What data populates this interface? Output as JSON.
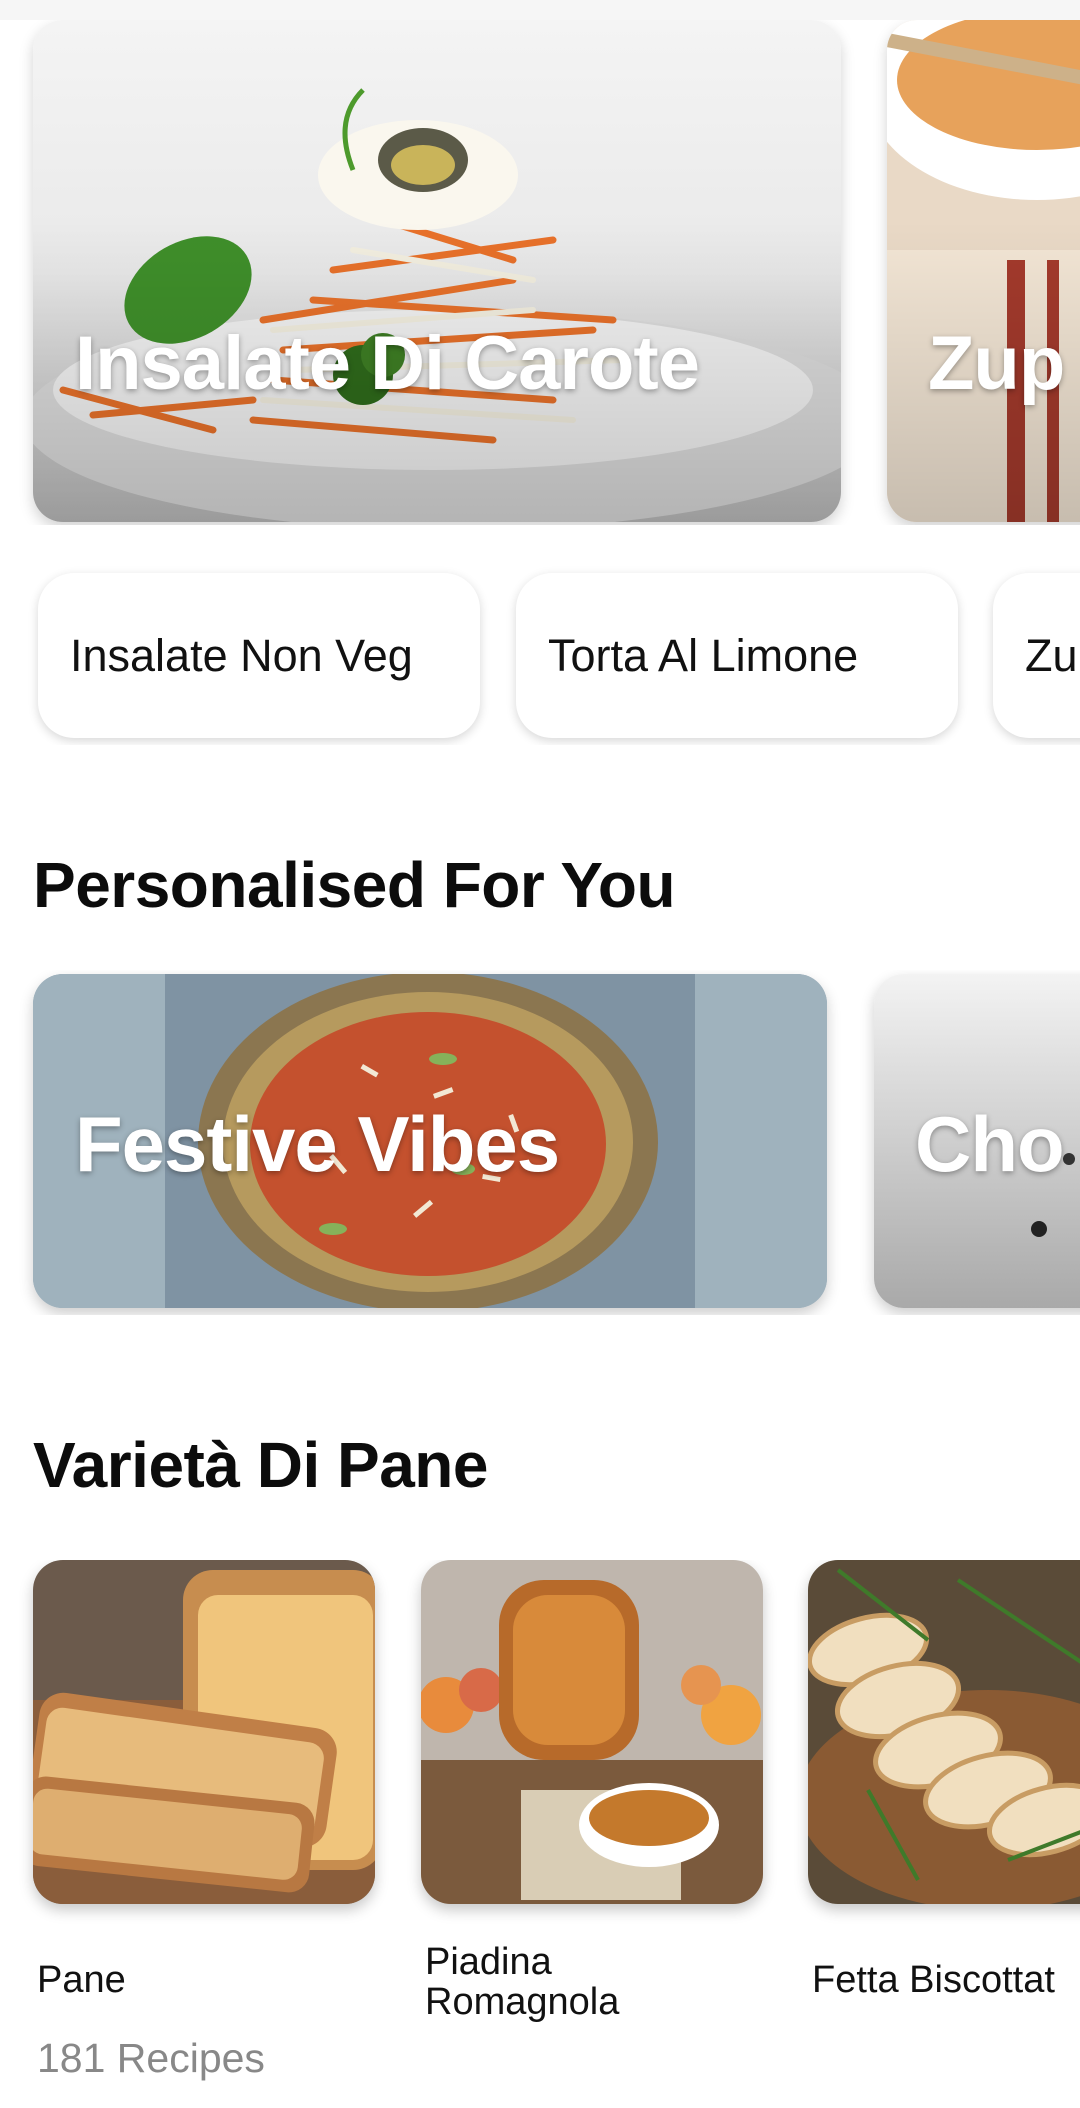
{
  "hero_cards": [
    {
      "title": "Insalate Di Carote"
    },
    {
      "title": "Zup"
    }
  ],
  "chips": [
    {
      "label": "Insalate Non Veg"
    },
    {
      "label": "Torta Al Limone"
    },
    {
      "label": "Zu"
    }
  ],
  "sections": {
    "personalised": {
      "title": "Personalised For You"
    },
    "bread": {
      "title": "Varietà Di Pane"
    }
  },
  "personalised_cards": [
    {
      "title": "Festive Vibes"
    },
    {
      "title": "Cho"
    }
  ],
  "bread_tiles": [
    {
      "name": "Pane",
      "meta": "181 Recipes"
    },
    {
      "name_line1": "Piadina",
      "name_line2": "Romagnola"
    },
    {
      "name": "Fetta Biscottat"
    }
  ]
}
